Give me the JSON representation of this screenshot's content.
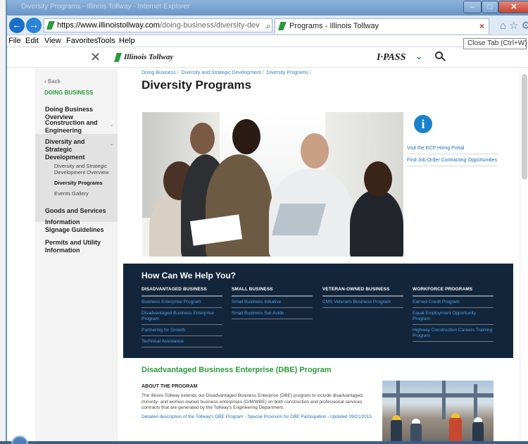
{
  "browser": {
    "window_title": "Diversity Programs - Illinois Tollway - Internet Explorer",
    "url_host": "https://www.illinoistollway.com",
    "url_path": "/doing-business/diversity-dev",
    "tab_title": "Programs - Illinois Tollway",
    "tab_close": "×",
    "tooltip": "Close Tab (Ctrl+W)",
    "menu": [
      "File",
      "Edit",
      "View",
      "Favorites",
      "Tools",
      "Help"
    ],
    "icons": [
      "back-icon",
      "forward-icon",
      "search-icon",
      "lock-icon",
      "refresh-icon",
      "home-icon",
      "star-icon",
      "gear-icon"
    ]
  },
  "site": {
    "close_glyph": "✕",
    "logo_text": "Illinois Tollway",
    "ipass": "I·PASS",
    "ipass_chev": "⌄"
  },
  "sidebar": {
    "back": "‹ Back",
    "heading": "DOING BUSINESS",
    "items": [
      {
        "label": "Doing Business Overview"
      },
      {
        "label": "Construction and Engineering"
      },
      {
        "label": "Diversity and Strategic Development"
      },
      {
        "label": "Goods and Services"
      },
      {
        "label": "Information Signage Guidelines"
      },
      {
        "label": "Permits and Utility Information"
      }
    ],
    "subitems": [
      {
        "label": "Diversity and Strategic Development Overview"
      },
      {
        "label": "Diversity Programs"
      },
      {
        "label": "Events Gallery"
      }
    ]
  },
  "main": {
    "breadcrumb": [
      "Doing Business",
      "Diversity and Strategic Development",
      "Diversity Programs"
    ],
    "title": "Diversity Programs",
    "right_links": [
      "Visit the ECP Hiring Portal",
      "Find Job Order Contracting Opportunities"
    ],
    "help": {
      "title": "How Can We Help You?",
      "columns": [
        {
          "head": "DISADVANTAGED BUSINESS",
          "links": [
            "Business Enterprise Program",
            "Disadvantaged Business Enterprise Program",
            "Partnering for Growth",
            "Technical Assistance"
          ]
        },
        {
          "head": "SMALL BUSINESS",
          "links": [
            "Small Business Initiative",
            "Small Business Set-Aside"
          ]
        },
        {
          "head": "VETERAN-OWNED BUSINESS",
          "links": [
            "CMS Veterans Business Program"
          ]
        },
        {
          "head": "WORKFORCE PROGRAMS",
          "links": [
            "Earned Credit Program",
            "Equal Employment Opportunity Program",
            "Highway Construction Careers Training Program"
          ]
        }
      ]
    },
    "dbe": {
      "title": "Disadvantaged Business Enterprise (DBE) Program",
      "about_head": "ABOUT THE PROGRAM",
      "about_text": "The Illinois Tollway extends our Disadvantaged Business Enterprise (DBE) program to include disadvantaged, minority- and women-owned business enterprises (D/M/WBE) on both construction and professional services contracts that are generated by the Tollway's Engineering Department.",
      "detail_link": "Detailed description of the Tollway's DBE Program - Special Provision for DBE Participation - Updated 09/21/2015"
    }
  }
}
